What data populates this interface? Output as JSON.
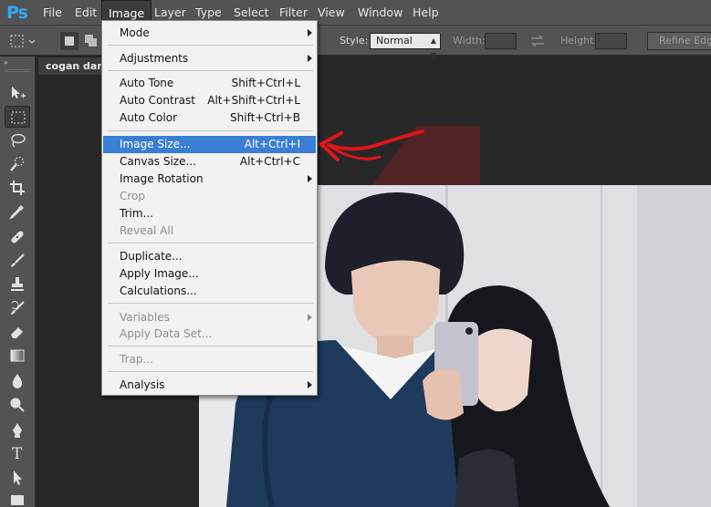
{
  "app": {
    "logo": "Ps"
  },
  "menubar": {
    "items": [
      {
        "id": "file",
        "label": "File"
      },
      {
        "id": "edit",
        "label": "Edit"
      },
      {
        "id": "image",
        "label": "Image",
        "active": true
      },
      {
        "id": "layer",
        "label": "Layer"
      },
      {
        "id": "type",
        "label": "Type"
      },
      {
        "id": "select",
        "label": "Select"
      },
      {
        "id": "filter",
        "label": "Filter"
      },
      {
        "id": "view",
        "label": "View"
      },
      {
        "id": "window",
        "label": "Window"
      },
      {
        "id": "help",
        "label": "Help"
      }
    ]
  },
  "options_bar": {
    "style_label": "Style:",
    "style_value": "Normal",
    "width_label": "Width:",
    "height_label": "Height:",
    "refine_edge_label": "Refine Edge..."
  },
  "toolbar": {
    "collapse_glyph": "»",
    "tools": [
      {
        "id": "move",
        "icon": "move-tool-icon"
      },
      {
        "id": "marquee",
        "icon": "rectangular-marquee-icon",
        "selected": true
      },
      {
        "id": "lasso",
        "icon": "lasso-icon"
      },
      {
        "id": "quick-select",
        "icon": "quick-selection-icon"
      },
      {
        "id": "crop",
        "icon": "crop-icon"
      },
      {
        "id": "eyedropper",
        "icon": "eyedropper-icon"
      },
      {
        "id": "healing",
        "icon": "healing-brush-icon"
      },
      {
        "id": "brush",
        "icon": "brush-icon"
      },
      {
        "id": "stamp",
        "icon": "clone-stamp-icon"
      },
      {
        "id": "history-brush",
        "icon": "history-brush-icon"
      },
      {
        "id": "eraser",
        "icon": "eraser-icon"
      },
      {
        "id": "gradient",
        "icon": "gradient-icon"
      },
      {
        "id": "blur",
        "icon": "blur-icon"
      },
      {
        "id": "dodge",
        "icon": "dodge-icon"
      },
      {
        "id": "pen",
        "icon": "pen-icon"
      },
      {
        "id": "type",
        "icon": "type-tool-icon",
        "glyph": "T"
      },
      {
        "id": "path-select",
        "icon": "path-selection-icon"
      },
      {
        "id": "shape",
        "icon": "rectangle-shape-icon"
      }
    ]
  },
  "document": {
    "tab_title": "cogan dan c"
  },
  "image_menu": {
    "items": [
      {
        "label": "Mode",
        "shortcut": "",
        "submenu": true,
        "disabled": false
      },
      {
        "sep": true
      },
      {
        "label": "Adjustments",
        "shortcut": "",
        "submenu": true,
        "disabled": false
      },
      {
        "sep": true
      },
      {
        "label": "Auto Tone",
        "shortcut": "Shift+Ctrl+L",
        "submenu": false,
        "disabled": false
      },
      {
        "label": "Auto Contrast",
        "shortcut": "Alt+Shift+Ctrl+L",
        "submenu": false,
        "disabled": false
      },
      {
        "label": "Auto Color",
        "shortcut": "Shift+Ctrl+B",
        "submenu": false,
        "disabled": false
      },
      {
        "sep": true
      },
      {
        "label": "Image Size...",
        "shortcut": "Alt+Ctrl+I",
        "submenu": false,
        "disabled": false,
        "highlighted": true
      },
      {
        "label": "Canvas Size...",
        "shortcut": "Alt+Ctrl+C",
        "submenu": false,
        "disabled": false
      },
      {
        "label": "Image Rotation",
        "shortcut": "",
        "submenu": true,
        "disabled": false
      },
      {
        "label": "Crop",
        "shortcut": "",
        "submenu": false,
        "disabled": true
      },
      {
        "label": "Trim...",
        "shortcut": "",
        "submenu": false,
        "disabled": false
      },
      {
        "label": "Reveal All",
        "shortcut": "",
        "submenu": false,
        "disabled": true
      },
      {
        "sep": true
      },
      {
        "label": "Duplicate...",
        "shortcut": "",
        "submenu": false,
        "disabled": false
      },
      {
        "label": "Apply Image...",
        "shortcut": "",
        "submenu": false,
        "disabled": false
      },
      {
        "label": "Calculations...",
        "shortcut": "",
        "submenu": false,
        "disabled": false
      },
      {
        "sep": true
      },
      {
        "label": "Variables",
        "shortcut": "",
        "submenu": true,
        "disabled": true
      },
      {
        "label": "Apply Data Set...",
        "shortcut": "",
        "submenu": false,
        "disabled": true
      },
      {
        "sep": true
      },
      {
        "label": "Trap...",
        "shortcut": "",
        "submenu": false,
        "disabled": true
      },
      {
        "sep": true
      },
      {
        "label": "Analysis",
        "shortcut": "",
        "submenu": true,
        "disabled": false
      }
    ]
  },
  "colors": {
    "menu_highlight": "#3b7fd4",
    "annotation_red": "#e0141b",
    "ps_blue": "#31a8ff"
  }
}
